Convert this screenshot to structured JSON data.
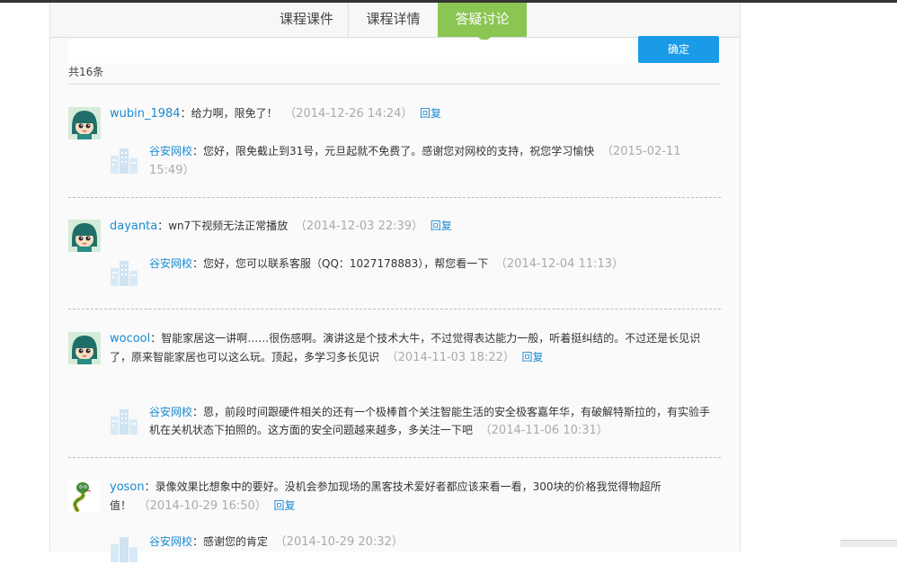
{
  "tabs": [
    "课程课件",
    "课程详情",
    "答疑讨论"
  ],
  "confirm_label": "确定",
  "total": "共16条",
  "reply_label": "回复",
  "colors": {
    "accent_green": "#8bc552",
    "button_blue": "#1a9be8",
    "link_blue": "#1a8ad2"
  },
  "comments": [
    {
      "user": "wubin_1984",
      "text": "：给力啊，限免了！",
      "time": "（2014-12-26 14:24）",
      "answer": {
        "user": "谷安网校",
        "text": "：您好，限免截止到31号，元旦起就不免费了。感谢您对网校的支持，祝您学习愉快",
        "time": "（2015-02-11 15:49）"
      }
    },
    {
      "user": "dayanta",
      "text": "：wn7下视频无法正常播放",
      "time": "（2014-12-03 22:39）",
      "answer": {
        "user": "谷安网校",
        "text": "：您好，您可以联系客服（QQ：1027178883），帮您看一下",
        "time": "（2014-12-04 11:13）"
      }
    },
    {
      "user": "wocool",
      "text": "：智能家居这一讲啊……很伤感啊。演讲这是个技术大牛，不过觉得表达能力一般，听着挺纠结的。不过还是长见识了，原来智能家居也可以这么玩。顶起，多学习多长见识",
      "time": "（2014-11-03 18:22）",
      "answer": {
        "user": "谷安网校",
        "text": "：恩，前段时间跟硬件相关的还有一个极棒首个关注智能生活的安全极客嘉年华，有破解特斯拉的，有实验手机在关机状态下拍照的。这方面的安全问题越来越多，多关注一下吧",
        "time": "（2014-11-06 10:31）"
      }
    },
    {
      "user": "yoson",
      "text": "：录像效果比想象中的要好。没机会参加现场的黑客技术爱好者都应该来看一看，300块的价格我觉得物超所值！",
      "time": "（2014-10-29 16:50）",
      "answer": {
        "user": "谷安网校",
        "text": "：感谢您的肯定",
        "time": "（2014-10-29 20:32）"
      }
    }
  ]
}
